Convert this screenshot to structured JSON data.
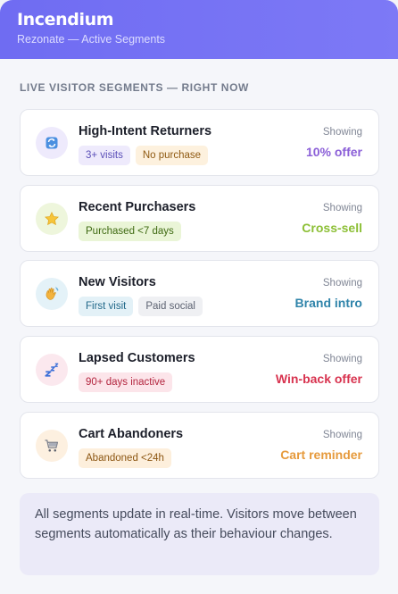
{
  "header": {
    "brand": "Incendium",
    "subtitle": "Rezonate — Active Segments"
  },
  "section_title": "LIVE VISITOR SEGMENTS — RIGHT NOW",
  "segments": [
    {
      "name": "High-Intent Returners",
      "icon": "refresh-icon",
      "icon_bg": "#eeeafc",
      "tags": [
        {
          "label": "3+ visits",
          "bg": "#eeeafc",
          "color": "#5b4fb8"
        },
        {
          "label": "No purchase",
          "bg": "#fdf1de",
          "color": "#8f5a12"
        }
      ],
      "showing_label": "Showing",
      "offer": "10% offer",
      "offer_color": "#8b5fd8"
    },
    {
      "name": "Recent Purchasers",
      "icon": "star-icon",
      "icon_bg": "#eef6dc",
      "tags": [
        {
          "label": "Purchased <7 days",
          "bg": "#eaf5d7",
          "color": "#3f6a12"
        }
      ],
      "showing_label": "Showing",
      "offer": "Cross-sell",
      "offer_color": "#8cbf35"
    },
    {
      "name": "New Visitors",
      "icon": "waving-hand-icon",
      "icon_bg": "#e4f2f8",
      "tags": [
        {
          "label": "First visit",
          "bg": "#e3f1f7",
          "color": "#22698a"
        },
        {
          "label": "Paid social",
          "bg": "#eff0f3",
          "color": "#5d6372"
        }
      ],
      "showing_label": "Showing",
      "offer": "Brand intro",
      "offer_color": "#2f84aa"
    },
    {
      "name": "Lapsed Customers",
      "icon": "sleep-icon",
      "icon_bg": "#fbe8ee",
      "tags": [
        {
          "label": "90+ days inactive",
          "bg": "#fce5ea",
          "color": "#b3263f"
        }
      ],
      "showing_label": "Showing",
      "offer": "Win-back offer",
      "offer_color": "#d8334f"
    },
    {
      "name": "Cart Abandoners",
      "icon": "shopping-cart-icon",
      "icon_bg": "#fdf0e0",
      "tags": [
        {
          "label": "Abandoned <24h",
          "bg": "#fdefdc",
          "color": "#8c5612"
        }
      ],
      "showing_label": "Showing",
      "offer": "Cart reminder",
      "offer_color": "#e69a3c"
    }
  ],
  "note": "All segments update in real-time. Visitors move between segments automatically as their behaviour changes."
}
